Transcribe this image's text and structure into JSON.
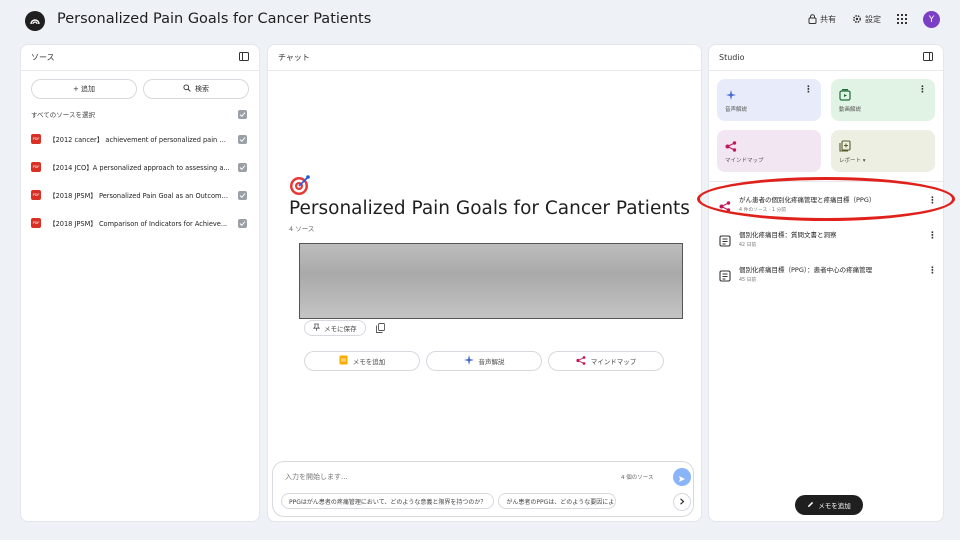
{
  "app": {
    "title": "Personalized Pain Goals for Cancer Patients",
    "share_label": "共有",
    "settings_label": "設定",
    "avatar_initial": "Y",
    "icons": [
      "app-logo-icon",
      "lock-icon",
      "gear-icon",
      "apps-grid-icon"
    ]
  },
  "sources": {
    "header": "ソース",
    "add_label": "+ 追加",
    "search_label": "検索",
    "select_all_label": "すべてのソースを選択",
    "items": [
      {
        "label": "【2012 cancer】 achievement of personalized pain go..."
      },
      {
        "label": "【2014 JCO】A personalized approach to assessing a..."
      },
      {
        "label": "【2018 JPSM】 Personalized Pain Goal as an Outcome..."
      },
      {
        "label": "【2018 JPSM】 Comparison of Indicators for Achieve..."
      }
    ]
  },
  "chat": {
    "header": "チャット",
    "notebook_title": "Personalized Pain Goals for Cancer Patients",
    "source_count": "4 ソース",
    "save_memo_label": "メモに保存",
    "actions": [
      {
        "label": "メモを追加"
      },
      {
        "label": "音声解説"
      },
      {
        "label": "マインドマップ"
      }
    ],
    "input_placeholder": "入力を開始します...",
    "input_source_count": "4 個のソース",
    "suggestions": [
      "PPGはがん患者の疼痛管理において、どのような意義と限界を持つのか？",
      "がん患者のPPGは、どのような要因によ"
    ]
  },
  "studio": {
    "header": "Studio",
    "tiles": [
      {
        "label": "音声解説",
        "color": "#e8ecfa"
      },
      {
        "label": "動画解説",
        "color": "#e1f3e4"
      },
      {
        "label": "マインドマップ",
        "color": "#f3e6f3"
      },
      {
        "label": "レポート ▾",
        "color": "#eeefe3"
      }
    ],
    "notes": [
      {
        "title": "がん患者の個別化疼痛管理と疼痛目標（PPG）",
        "meta": "4 件のソース · 1 分前"
      },
      {
        "title": "個別化疼痛目標：質問文書と洞察",
        "meta": "42 日前"
      },
      {
        "title": "個別化疼痛目標（PPG）：患者中心の疼痛管理",
        "meta": "45 日前"
      }
    ],
    "add_note_label": "メモを追加",
    "highlight_color": "#e0211b"
  }
}
